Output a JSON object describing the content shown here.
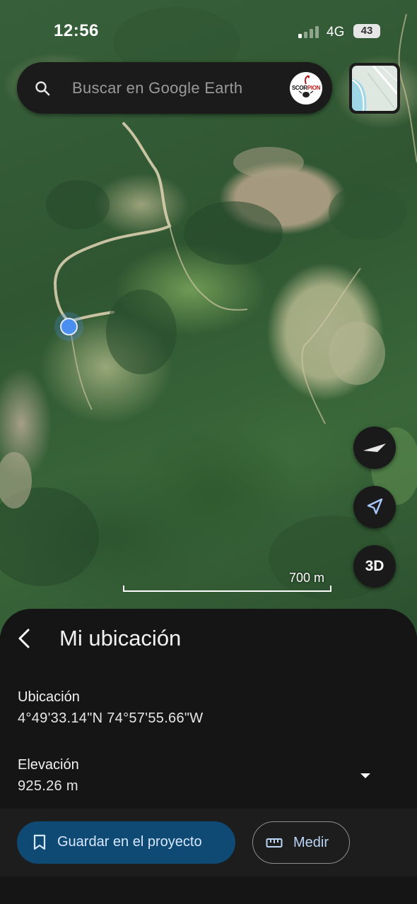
{
  "status_bar": {
    "time": "12:56",
    "network": "4G",
    "battery": "43"
  },
  "search": {
    "placeholder": "Buscar en Google Earth",
    "avatar_text_black": "SCOR",
    "avatar_text_red": "PION"
  },
  "map": {
    "scale_label": "700 m",
    "button_3d": "3D"
  },
  "sheet": {
    "title": "Mi ubicación",
    "location_label": "Ubicación",
    "location_value": "4°49'33.14\"N 74°57'55.66\"W",
    "elevation_label": "Elevación",
    "elevation_value": "925.26 m"
  },
  "actions": {
    "save_label": "Guardar en el proyecto",
    "measure_label": "Medir"
  },
  "colors": {
    "location_dot": "#4a8ff0",
    "save_button_bg": "#0f4a75",
    "sheet_bg": "#151515",
    "compass_red": "#e23b3b"
  },
  "icons": [
    "search-icon",
    "avatar",
    "layers-icon",
    "compass-icon",
    "navigation-arrow-icon",
    "back-chevron-icon",
    "dropdown-arrow-icon",
    "bookmark-icon",
    "ruler-icon"
  ]
}
